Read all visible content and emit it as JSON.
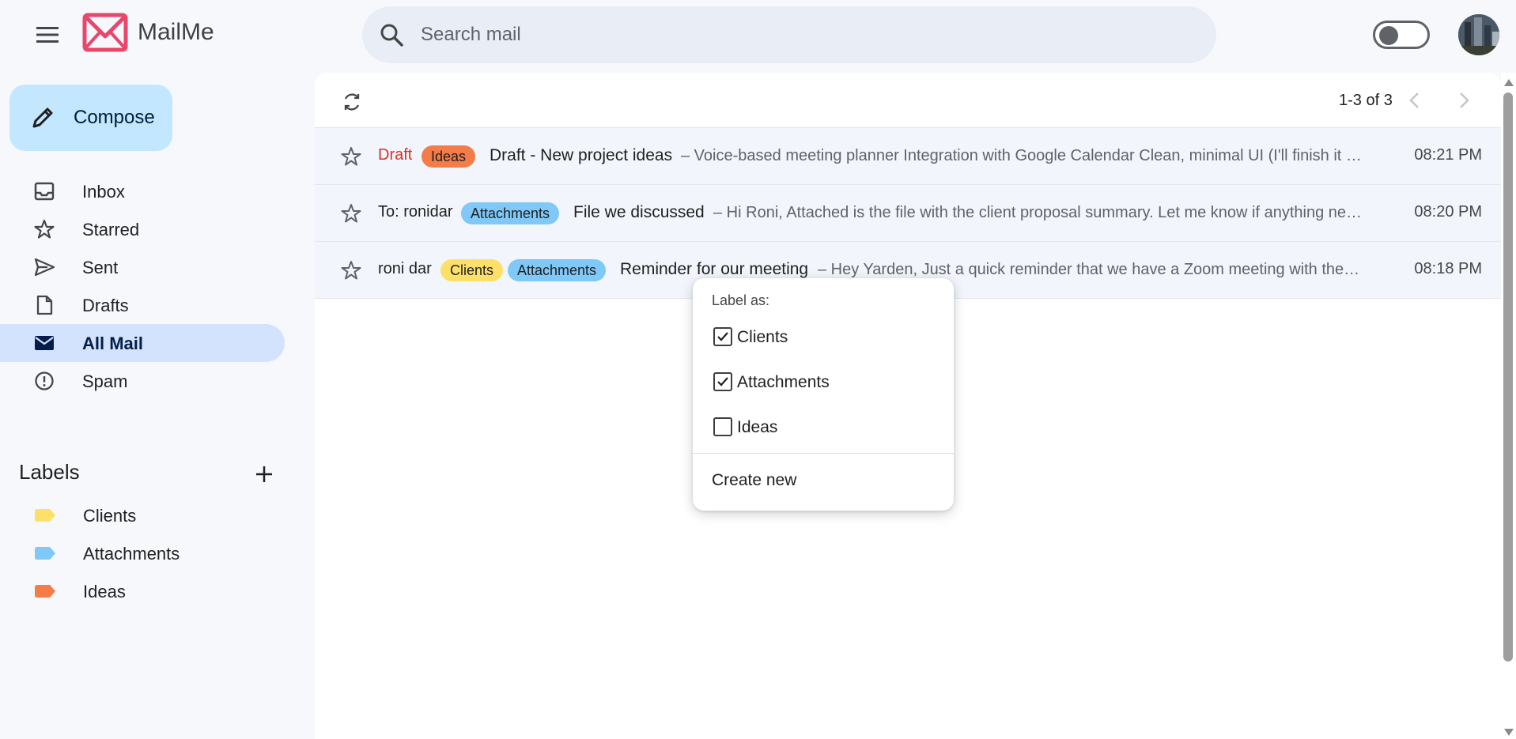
{
  "app": {
    "name": "MailMe",
    "brand_color": "#e8466a"
  },
  "header": {
    "menu_icon": "hamburger-icon",
    "search": {
      "placeholder": "Search mail",
      "value": ""
    },
    "theme_toggle": {
      "state": "off"
    }
  },
  "sidebar": {
    "compose_label": "Compose",
    "items": [
      {
        "label": "Inbox",
        "icon": "inbox-icon",
        "active": false
      },
      {
        "label": "Starred",
        "icon": "star-icon",
        "active": false
      },
      {
        "label": "Sent",
        "icon": "send-icon",
        "active": false
      },
      {
        "label": "Drafts",
        "icon": "draft-file-icon",
        "active": false
      },
      {
        "label": "All Mail",
        "icon": "mail-icon",
        "active": true
      },
      {
        "label": "Spam",
        "icon": "spam-icon",
        "active": false
      }
    ],
    "labels_title": "Labels",
    "labels": [
      {
        "label": "Clients",
        "color": "#fde06a"
      },
      {
        "label": "Attachments",
        "color": "#7fc8f8"
      },
      {
        "label": "Ideas",
        "color": "#f47c48"
      }
    ]
  },
  "toolbar": {
    "pager": "1-3 of 3"
  },
  "emails": [
    {
      "sender": "Draft",
      "is_draft": true,
      "labels": [
        {
          "name": "Ideas",
          "color": "#f47c48"
        }
      ],
      "subject": "Draft - New project ideas",
      "snippet": "– Voice-based meeting planner Integration with Google Calendar Clean, minimal UI (I'll finish it later)",
      "time": "08:21 PM"
    },
    {
      "sender": "To: ronidar",
      "is_draft": false,
      "labels": [
        {
          "name": "Attachments",
          "color": "#7fc8f8"
        }
      ],
      "subject": "File we discussed",
      "snippet": "– Hi Roni, Attached is the file with the client proposal summary. Let me know if anything needs changes.",
      "time": "08:20 PM"
    },
    {
      "sender": "roni dar",
      "is_draft": false,
      "labels": [
        {
          "name": "Clients",
          "color": "#fde06a"
        },
        {
          "name": "Attachments",
          "color": "#7fc8f8"
        }
      ],
      "subject": "Reminder for our meeting",
      "snippet": "– Hey Yarden, Just a quick reminder that we have a Zoom meeting with the client tomorrow.",
      "time": "08:18 PM"
    }
  ],
  "label_menu": {
    "title": "Label as:",
    "options": [
      {
        "label": "Clients",
        "checked": true
      },
      {
        "label": "Attachments",
        "checked": true
      },
      {
        "label": "Ideas",
        "checked": false
      }
    ],
    "create_new": "Create new"
  }
}
